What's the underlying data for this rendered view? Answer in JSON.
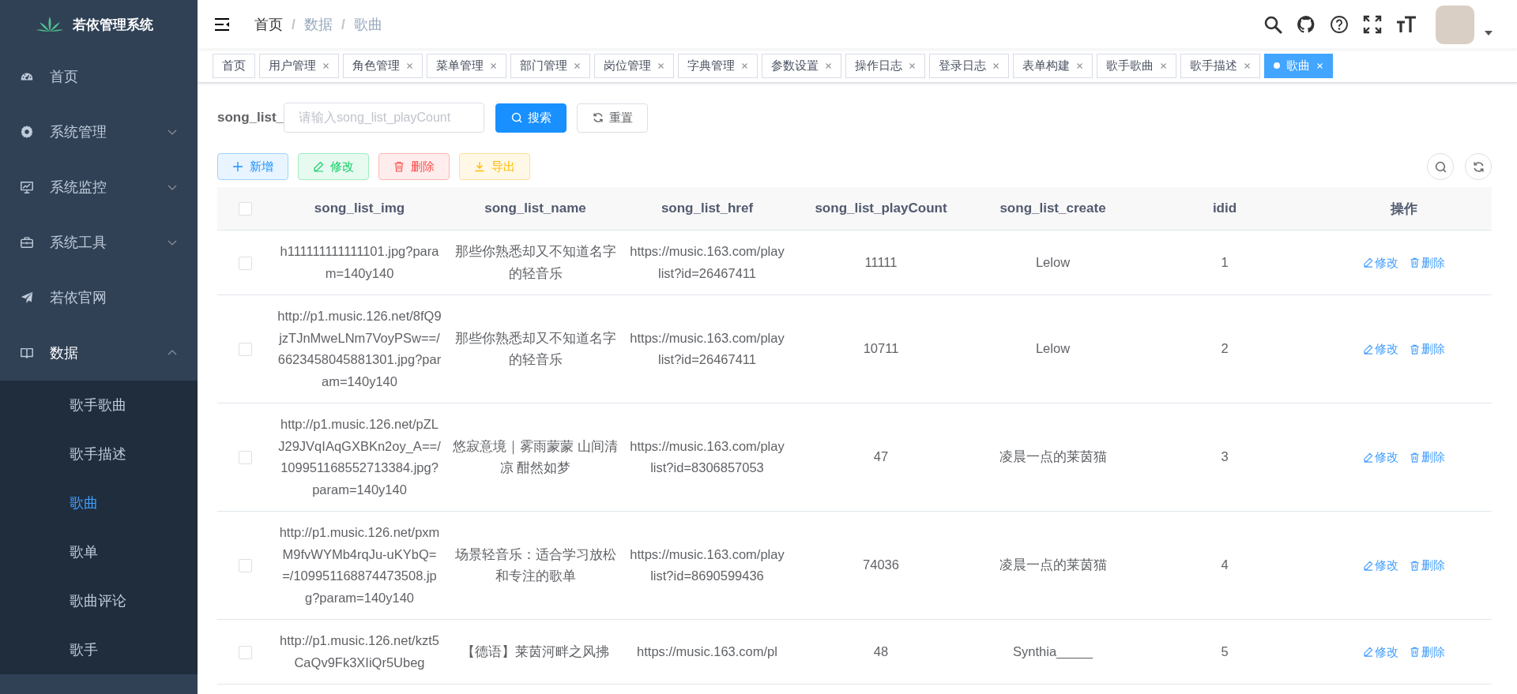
{
  "app": {
    "title": "若依管理系统"
  },
  "sidebar": {
    "items": [
      {
        "label": "首页",
        "expandable": false,
        "expanded": false
      },
      {
        "label": "系统管理",
        "expandable": true,
        "expanded": false
      },
      {
        "label": "系统监控",
        "expandable": true,
        "expanded": false
      },
      {
        "label": "系统工具",
        "expandable": true,
        "expanded": false
      },
      {
        "label": "若依官网",
        "expandable": false,
        "expanded": false
      },
      {
        "label": "数据",
        "expandable": true,
        "expanded": true,
        "children": [
          {
            "label": "歌手歌曲",
            "selected": false
          },
          {
            "label": "歌手描述",
            "selected": false
          },
          {
            "label": "歌曲",
            "selected": true
          },
          {
            "label": "歌单",
            "selected": false
          },
          {
            "label": "歌曲评论",
            "selected": false
          },
          {
            "label": "歌手",
            "selected": false
          }
        ]
      }
    ]
  },
  "breadcrumb": [
    {
      "label": "首页",
      "link": true
    },
    {
      "separator": "/",
      "label": "数据",
      "link": false
    },
    {
      "separator": "/",
      "label": "歌曲",
      "link": false
    }
  ],
  "tags": [
    {
      "label": "首页",
      "closable": false,
      "selected": false
    },
    {
      "label": "用户管理",
      "closable": true,
      "selected": false
    },
    {
      "label": "角色管理",
      "closable": true,
      "selected": false
    },
    {
      "label": "菜单管理",
      "closable": true,
      "selected": false
    },
    {
      "label": "部门管理",
      "closable": true,
      "selected": false
    },
    {
      "label": "岗位管理",
      "closable": true,
      "selected": false
    },
    {
      "label": "字典管理",
      "closable": true,
      "selected": false
    },
    {
      "label": "参数设置",
      "closable": true,
      "selected": false
    },
    {
      "label": "操作日志",
      "closable": true,
      "selected": false
    },
    {
      "label": "登录日志",
      "closable": true,
      "selected": false
    },
    {
      "label": "表单构建",
      "closable": true,
      "selected": false
    },
    {
      "label": "歌手歌曲",
      "closable": true,
      "selected": false
    },
    {
      "label": "歌手描述",
      "closable": true,
      "selected": false
    },
    {
      "label": "歌曲",
      "closable": true,
      "selected": true
    }
  ],
  "search": {
    "label": "song_list_",
    "placeholder": "请输入song_list_playCount",
    "buttons": [
      {
        "label": "搜索",
        "kind": "primary"
      },
      {
        "label": "重置",
        "kind": "default"
      }
    ]
  },
  "toolbar": [
    {
      "label": "新增",
      "kind": "primary"
    },
    {
      "label": "修改",
      "kind": "success"
    },
    {
      "label": "删除",
      "kind": "danger"
    },
    {
      "label": "导出",
      "kind": "warning"
    }
  ],
  "table": {
    "all_checked": false,
    "columns": [
      "song_list_img",
      "song_list_name",
      "song_list_href",
      "song_list_playCount",
      "song_list_create",
      "idid",
      "操作"
    ],
    "rows": [
      {
        "checked": false,
        "cells": [
          "h111111111111101.jpg?param=140y140",
          "那些你熟悉却又不知道名字的轻音乐",
          "https://music.163.com/playlist?id=26467411",
          "11111",
          "Lelow",
          "1"
        ],
        "actions": [
          "修改",
          "删除"
        ]
      },
      {
        "checked": false,
        "cells": [
          "http://p1.music.126.net/8fQ9jzTJnMweLNm7VoyPSw==/6623458045881301.jpg?param=140y140",
          "那些你熟悉却又不知道名字的轻音乐",
          "https://music.163.com/playlist?id=26467411",
          "10711",
          "Lelow",
          "2"
        ],
        "actions": [
          "修改",
          "删除"
        ]
      },
      {
        "checked": false,
        "cells": [
          "http://p1.music.126.net/pZLJ29JVqIAqGXBKn2oy_A==/109951168552713384.jpg?param=140y140",
          "悠寂意境｜雾雨蒙蒙 山间清凉 酣然如梦",
          "https://music.163.com/playlist?id=8306857053",
          "47",
          "凌晨一点的莱茵猫",
          "3"
        ],
        "actions": [
          "修改",
          "删除"
        ]
      },
      {
        "checked": false,
        "cells": [
          "http://p1.music.126.net/pxmM9fvWYMb4rqJu-uKYbQ==/109951168874473508.jpg?param=140y140",
          "场景轻音乐：适合学习放松和专注的歌单",
          "https://music.163.com/playlist?id=8690599436",
          "74036",
          "凌晨一点的莱茵猫",
          "4"
        ],
        "actions": [
          "修改",
          "删除"
        ]
      },
      {
        "checked": false,
        "cells": [
          "http://p1.music.126.net/kzt5CaQv9Fk3XIiQr5Ubeg",
          "【德语】莱茵河畔之风拂",
          "https://music.163.com/pl",
          "48",
          "Synthia_____",
          "5"
        ],
        "actions": [
          "修改",
          "删除"
        ]
      }
    ]
  }
}
